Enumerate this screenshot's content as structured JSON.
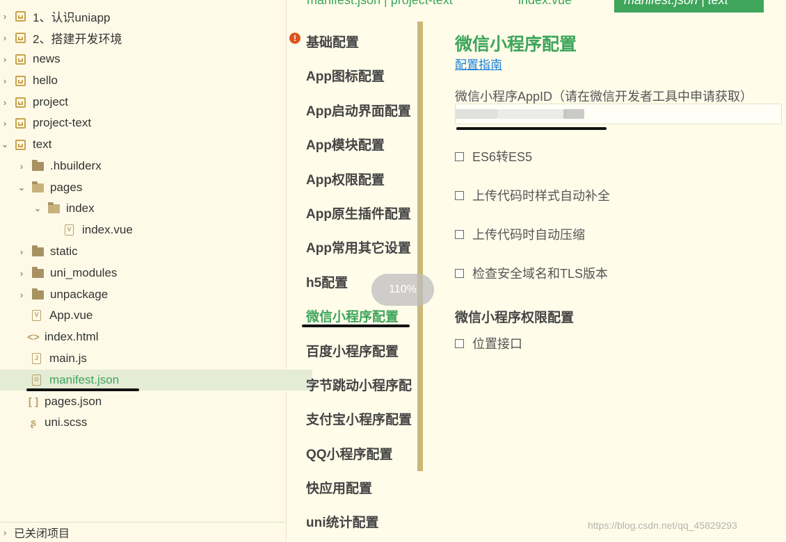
{
  "tree": {
    "items": [
      {
        "label": "1、认识uniapp"
      },
      {
        "label": "2、搭建开发环境"
      },
      {
        "label": "news"
      },
      {
        "label": "hello"
      },
      {
        "label": "project"
      },
      {
        "label": "project-text"
      },
      {
        "label": "text"
      },
      {
        "label": ".hbuilderx"
      },
      {
        "label": "pages"
      },
      {
        "label": "index"
      },
      {
        "label": "index.vue"
      },
      {
        "label": "static"
      },
      {
        "label": "uni_modules"
      },
      {
        "label": "unpackage"
      },
      {
        "label": "App.vue"
      },
      {
        "label": "index.html"
      },
      {
        "label": "main.js"
      },
      {
        "label": "manifest.json"
      },
      {
        "label": "pages.json"
      },
      {
        "label": "uni.scss"
      }
    ],
    "closed_projects": "已关闭项目",
    "accent_color": "#3ea55a"
  },
  "tabs": {
    "tab1": "manifest.json | project-text",
    "tab2": "index.vue",
    "active": "manifest.json | text"
  },
  "nav": {
    "items": [
      {
        "label": "基础配置"
      },
      {
        "label": "App图标配置"
      },
      {
        "label": "App启动界面配置"
      },
      {
        "label": "App模块配置"
      },
      {
        "label": "App权限配置"
      },
      {
        "label": "App原生插件配置"
      },
      {
        "label": "App常用其它设置"
      },
      {
        "label": "h5配置"
      },
      {
        "label": "微信小程序配置"
      },
      {
        "label": "百度小程序配置"
      },
      {
        "label": "字节跳动小程序配"
      },
      {
        "label": "支付宝小程序配置"
      },
      {
        "label": "QQ小程序配置"
      },
      {
        "label": "快应用配置"
      },
      {
        "label": "uni统计配置"
      }
    ],
    "active_index": 8
  },
  "zoom": "110%",
  "main": {
    "title": "微信小程序配置",
    "guide_link": "配置指南",
    "appid_label": "微信小程序AppID（请在微信开发者工具中申请获取）",
    "checkboxes": [
      {
        "label": "ES6转ES5",
        "checked": false
      },
      {
        "label": "上传代码时样式自动补全",
        "checked": false
      },
      {
        "label": "上传代码时自动压缩",
        "checked": false
      },
      {
        "label": "检查安全域名和TLS版本",
        "checked": false
      }
    ],
    "permissions_title": "微信小程序权限配置",
    "permissions": [
      {
        "label": "位置接口",
        "checked": false
      }
    ]
  },
  "watermark": "https://blog.csdn.net/qq_45829293"
}
